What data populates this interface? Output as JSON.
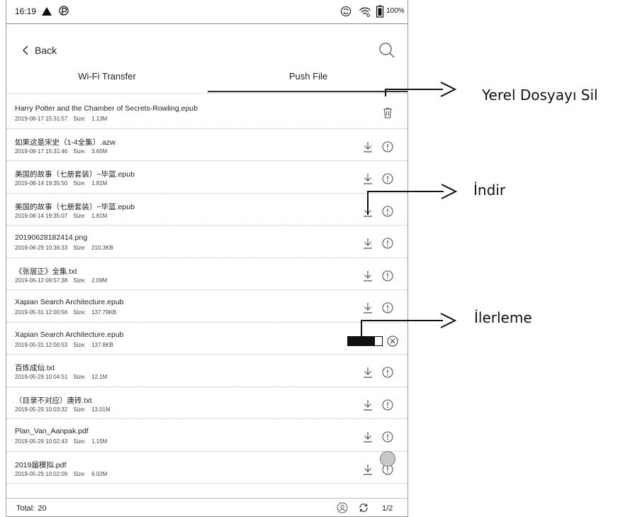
{
  "status_bar": {
    "time": "16:19",
    "battery": "100%",
    "icons": [
      "warning-icon",
      "p-badge-icon",
      "sync-icon",
      "wifi-icon",
      "battery-icon"
    ]
  },
  "header": {
    "back_label": "Back",
    "search_icon": "search-icon"
  },
  "tabs": [
    {
      "label": "Wi-Fi Transfer",
      "active": false
    },
    {
      "label": "Push File",
      "active": true
    }
  ],
  "size_prefix": "Size:",
  "files": [
    {
      "name": "Harry Potter and the Chamber of Secrets-Rowling.epub",
      "date": "2019-08-17 15:31:57",
      "size": "1.13M",
      "state": "downloaded"
    },
    {
      "name": "如果这是宋史（1-4全集）.azw",
      "date": "2019-08-17 15:31:46",
      "size": "3.65M",
      "state": "available"
    },
    {
      "name": "美国的故事（七册套装）−毕蓝.epub",
      "date": "2019-08-14 19:35:50",
      "size": "1.81M",
      "state": "available"
    },
    {
      "name": "美国的故事（七册套装）−毕蓝.epub",
      "date": "2019-08-14 19:35:07",
      "size": "1.81M",
      "state": "available"
    },
    {
      "name": "20190628182414.png",
      "date": "2019-06-29 10:36:33",
      "size": "210.3KB",
      "state": "available"
    },
    {
      "name": "《张居正》全集.txt",
      "date": "2019-06-12 09:57:38",
      "size": "2.09M",
      "state": "available"
    },
    {
      "name": "Xapian Search Architecture.epub",
      "date": "2019-05-31 12:00:56",
      "size": "137.79KB",
      "state": "available"
    },
    {
      "name": "Xapian Search Architecture.epub",
      "date": "2019-05-31 12:00:53",
      "size": "137.8KB",
      "state": "downloading",
      "progress": 0.8
    },
    {
      "name": "百炼成仙.txt",
      "date": "2019-05-29 10:04:51",
      "size": "12.1M",
      "state": "available"
    },
    {
      "name": "（目录不对应）唐砖.txt",
      "date": "2019-05-29 10:03:32",
      "size": "13.01M",
      "state": "available"
    },
    {
      "name": "Plan_Van_Aanpak.pdf",
      "date": "2019-05-29 10:02:43",
      "size": "1.15M",
      "state": "available"
    },
    {
      "name": "2019届模拟.pdf",
      "date": "2019-05-29 10:02:09",
      "size": "6.02M",
      "state": "available"
    }
  ],
  "footer": {
    "total_label": "Total:",
    "total_count": "20",
    "page": "1/2"
  },
  "callouts": [
    {
      "label": "Yerel Dosyayı Sil"
    },
    {
      "label": "İndir"
    },
    {
      "label": "İlerleme"
    }
  ]
}
